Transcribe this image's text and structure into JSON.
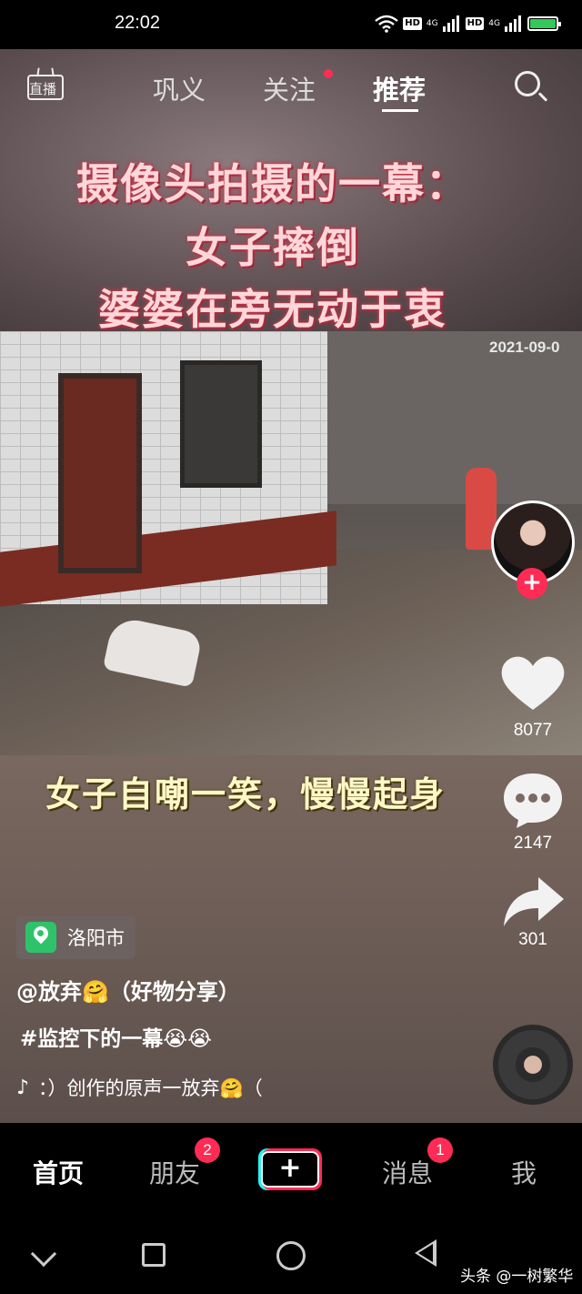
{
  "status_bar": {
    "time": "22:02",
    "network_labels": [
      "HD",
      "4G",
      "HD",
      "4G"
    ],
    "battery_color": "#34c759"
  },
  "top_nav": {
    "live_label": "直播",
    "tabs": [
      {
        "label": "巩义",
        "active": false
      },
      {
        "label": "关注",
        "active": false,
        "has_dot": true
      },
      {
        "label": "推荐",
        "active": true
      }
    ],
    "search_icon": "search-icon",
    "accent_color": "#fe2c55"
  },
  "video": {
    "caption_lines": [
      "摄像头拍摄的一幕：",
      "女子摔倒",
      "婆婆在旁无动于衷"
    ],
    "timestamp": "2021-09-0",
    "subtitle": "女子自嘲一笑，慢慢起身"
  },
  "right_rail": {
    "follow_icon": "+",
    "like_count": "8077",
    "comment_count": "2147",
    "share_count": "301"
  },
  "info": {
    "location": "洛阳市",
    "author": "@放弃🤗（好物分享）",
    "description": "#监控下的一幕😭😭",
    "music_icon": "♪",
    "music": "：）创作的原声一放弃🤗（"
  },
  "tab_bar": {
    "items": [
      {
        "label": "首页",
        "active": true
      },
      {
        "label": "朋友",
        "badge": "2"
      },
      {
        "label": "+"
      },
      {
        "label": "消息",
        "badge": "1"
      },
      {
        "label": "我"
      }
    ]
  },
  "watermark": "头条 @一树繁华"
}
